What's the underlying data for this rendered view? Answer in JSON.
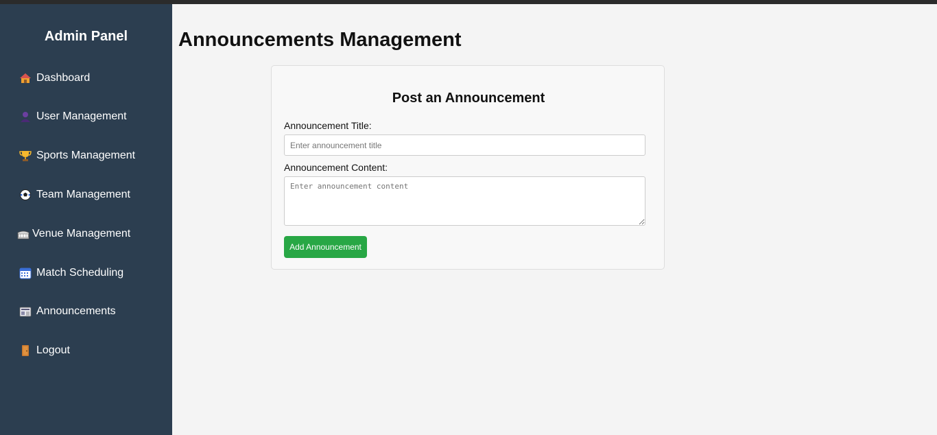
{
  "sidebar": {
    "title": "Admin Panel",
    "items": [
      {
        "icon": "house-icon",
        "label": "Dashboard"
      },
      {
        "icon": "user-icon",
        "label": "User Management"
      },
      {
        "icon": "trophy-icon",
        "label": "Sports Management"
      },
      {
        "icon": "soccer-ball-icon",
        "label": "Team Management"
      },
      {
        "icon": "stadium-icon",
        "label": "Venue Management"
      },
      {
        "icon": "calendar-icon",
        "label": "Match Scheduling"
      },
      {
        "icon": "newspaper-icon",
        "label": "Announcements"
      },
      {
        "icon": "door-icon",
        "label": "Logout"
      }
    ]
  },
  "main": {
    "title": "Announcements Management"
  },
  "form": {
    "heading": "Post an Announcement",
    "title_label": "Announcement Title:",
    "title_placeholder": "Enter announcement title",
    "title_value": "",
    "content_label": "Announcement Content:",
    "content_placeholder": "Enter announcement content",
    "content_value": "",
    "submit_label": "Add Announcement"
  },
  "colors": {
    "sidebar_bg": "#2c3e50",
    "page_bg": "#f4f4f4",
    "button_bg": "#28a745"
  }
}
